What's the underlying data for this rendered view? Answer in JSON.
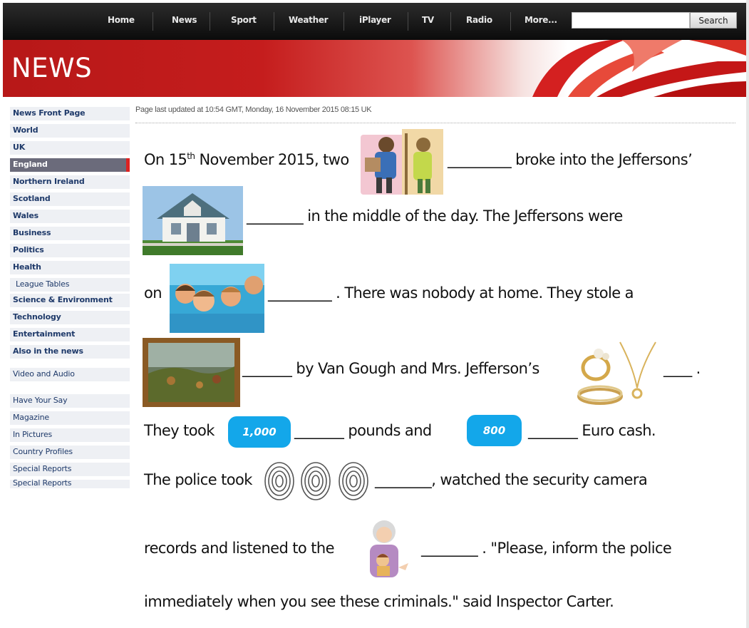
{
  "nav": {
    "items": [
      "Home",
      "News",
      "Sport",
      "Weather",
      "iPlayer",
      "TV",
      "Radio",
      "More..."
    ],
    "search_placeholder": "",
    "search_button": "Search"
  },
  "banner": {
    "title": "NEWS"
  },
  "sidebar": {
    "items": [
      "News Front Page",
      "World",
      "UK",
      "England",
      "Northern Ireland",
      "Scotland",
      "Wales",
      "Business",
      "Politics",
      "Health",
      "League Tables",
      "Science & Environment",
      "Technology",
      "Entertainment",
      "Also in the news",
      "Video and Audio",
      "Have Your Say",
      "Magazine",
      "In Pictures",
      "Country Profiles",
      "Special Reports",
      "Special Reports"
    ],
    "active": "England"
  },
  "article": {
    "updated": "Page last updated at 10:54 GMT, Monday, 16 November 2015   08:15 UK",
    "line1_a": "On 15",
    "line1_sup": "th",
    "line1_b": " November 2015, two",
    "line1_c": "_________ broke into the Jeffersons’",
    "line2": "________ in the middle of the day. The Jeffersons were",
    "line3_a": "on",
    "line3_b": "_________ . There was nobody at home. They stole a",
    "line4_a": "_______ by Van Gough and Mrs. Jefferson’s",
    "line4_b": "____ .",
    "line5_a": "They took",
    "badge1": "1,000",
    "line5_b": "_______ pounds and",
    "badge2": "800",
    "line5_c": "_______ Euro cash.",
    "line6_a": "The police took",
    "line6_b": "________, watched the security camera",
    "line7_a": "records and listened to the",
    "line7_b": "________ . \"Please, inform the police",
    "line8": "immediately when you see these criminals.\" said Inspector Carter."
  },
  "colors": {
    "nav_bg": "#111111",
    "banner_red": "#c51d1d",
    "badge_blue": "#13a7ea",
    "link_blue": "#1f3a6a"
  },
  "icons": [
    "thieves-picture-icon",
    "house-picture-icon",
    "family-pool-picture-icon",
    "painting-picture-icon",
    "jewellery-picture-icon",
    "fingerprint-icon",
    "grandmother-picture-icon"
  ]
}
